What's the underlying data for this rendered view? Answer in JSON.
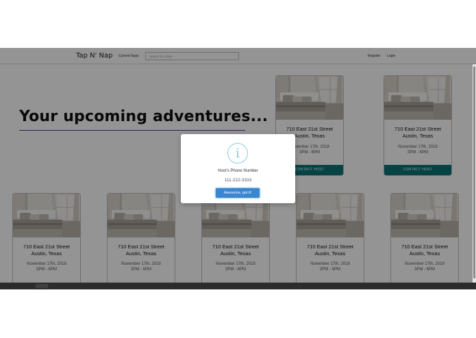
{
  "navbar": {
    "brand": "Tap N' Nap",
    "current_naps": "Current Naps",
    "search_placeholder": "Search for a bed",
    "register": "Register",
    "login": "Login"
  },
  "main": {
    "heading": "Your upcoming adventures..."
  },
  "cards": [
    {
      "street": "710 East 21st Street",
      "city": "Austin, Texas",
      "date": "November 17th, 2018",
      "time": "3PM - 6PM",
      "action": "CONTACT HOST"
    },
    {
      "street": "710 East 21st Street",
      "city": "Austin, Texas",
      "date": "November 17th, 2018",
      "time": "3PM - 6PM",
      "action": "CONTACT HOST"
    },
    {
      "street": "710 East 21st Street",
      "city": "Austin, Texas",
      "date": "November 17th, 2018",
      "time": "3PM - 6PM"
    },
    {
      "street": "710 East 21st Street",
      "city": "Austin, Texas",
      "date": "November 17th, 2018",
      "time": "3PM - 6PM"
    },
    {
      "street": "710 East 21st Street",
      "city": "Austin, Texas",
      "date": "November 17th, 2018",
      "time": "3PM - 6PM"
    },
    {
      "street": "710 East 21st Street",
      "city": "Austin, Texas",
      "date": "November 17th, 2018",
      "time": "3PM - 6PM"
    },
    {
      "street": "710 East 21st Street",
      "city": "Austin, Texas",
      "date": "November 17th, 2018",
      "time": "3PM - 6PM"
    }
  ],
  "modal": {
    "icon": "info-icon",
    "title": "Host's Phone Number",
    "phone": "111-222-3333",
    "confirm": "Awesome, got it!"
  },
  "colors": {
    "accent_teal": "#0d7377",
    "button_blue": "#3a86d1",
    "info_icon": "#87cbe8",
    "heading_underline": "#3a3aa0"
  }
}
